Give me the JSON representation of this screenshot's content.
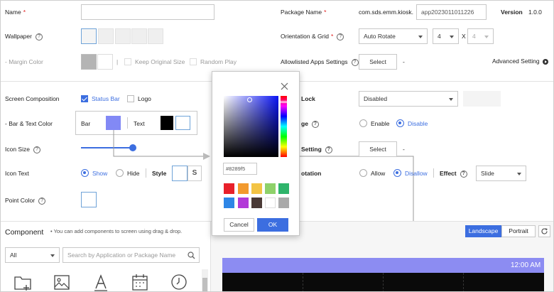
{
  "form": {
    "name_label": "Name",
    "required_mark": "*",
    "name_value": "",
    "wallpaper_label": "Wallpaper",
    "margin_color_label": "- Margin Color",
    "keep_original_size": "Keep Original Size",
    "random_play": "Random Play",
    "pipe": "|",
    "screen_composition_label": "Screen Composition",
    "status_bar": "Status Bar",
    "logo": "Logo",
    "bar_text_color_label": "- Bar & Text Color",
    "bar": "Bar",
    "text": "Text",
    "icon_size_label": "Icon Size",
    "icon_text_label": "Icon Text",
    "show": "Show",
    "hide": "Hide",
    "style": "Style",
    "style_s": "S",
    "point_color_label": "Point Color"
  },
  "right_form": {
    "package_name_label": "Package Name",
    "package_prefix": "com.sds.emm.kiosk.",
    "package_value": "app2023011011226",
    "version_label": "Version",
    "version_value": "1.0.0",
    "orientation_label": "Orientation & Grid",
    "orientation_value": "Auto Rotate",
    "grid_cols": "4",
    "grid_x": "X",
    "grid_rows": "4",
    "allowlisted_label": "Allowlisted Apps Settings",
    "select_btn": "Select",
    "dash": "-",
    "advanced_setting": "Advanced Setting",
    "lock_label": "Lock",
    "lock_value": "Disabled",
    "ge_label": "ge",
    "enable": "Enable",
    "disable": "Disable",
    "setting_label": "Setting",
    "select_btn2": "Select",
    "dash2": "-",
    "rotation_label": "otation",
    "allow": "Allow",
    "disallow": "Disallow",
    "effect_label": "Effect",
    "effect_value": "Slide"
  },
  "component": {
    "title": "Component",
    "hint": "• You can add components to screen using drag & drop.",
    "filter_value": "All",
    "search_placeholder": "Search by Application or Package Name",
    "icons": [
      "folder-add-icon",
      "image-icon",
      "text-icon",
      "calendar-icon",
      "clock-icon"
    ]
  },
  "preview": {
    "landscape": "Landscape",
    "portrait": "Portrait",
    "time": "12:00 AM"
  },
  "color_picker": {
    "hex_value": "#8289f5",
    "cancel": "Cancel",
    "ok": "OK",
    "swatches": [
      "#e8202a",
      "#f29a2e",
      "#f3c445",
      "#8ed16a",
      "#2fb46b",
      "#2e86e6",
      "#b23ad8",
      "#4a3a36",
      "#ffffff",
      "#aaaaaa"
    ]
  },
  "colors": {
    "accent": "#3c6ee0",
    "bar_color": "#8289f5",
    "text_color": "#000000",
    "preview_bar": "#8c8cf2",
    "preview_bg": "#0a0a0a"
  }
}
